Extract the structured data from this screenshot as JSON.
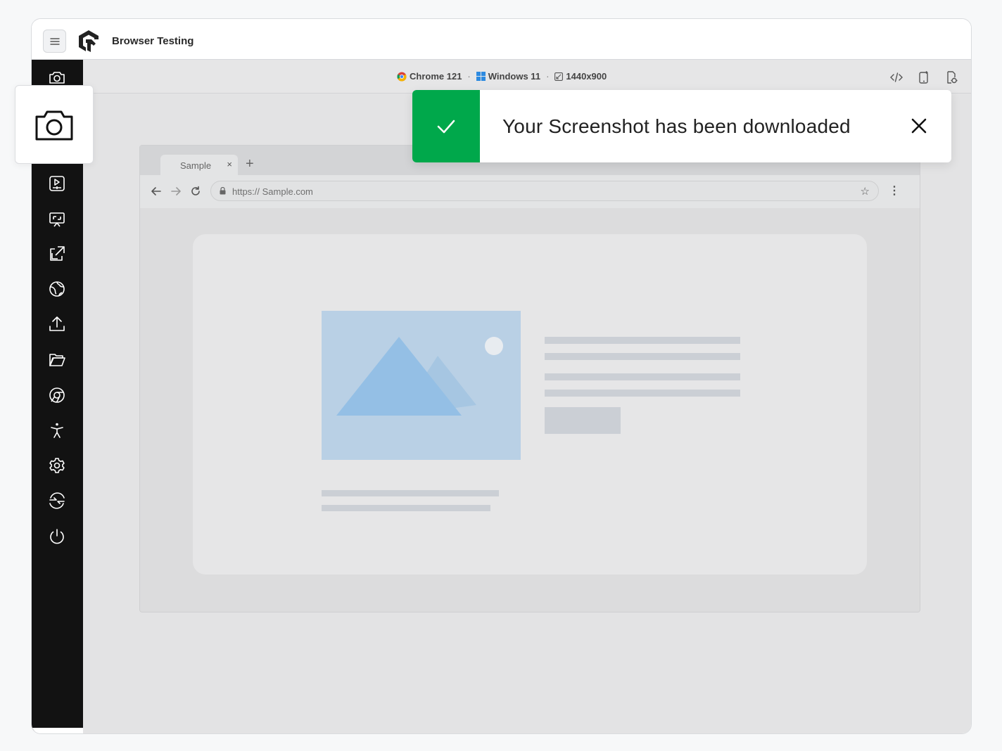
{
  "header": {
    "app_title": "Browser Testing",
    "menu_icon": "menu-icon",
    "logo": "brand-logo"
  },
  "sidebar": {
    "items": [
      {
        "name": "screenshot",
        "icon": "camera-icon"
      },
      {
        "name": "video-recording",
        "icon": "video-icon"
      },
      {
        "name": "switch-resolution",
        "icon": "monitor-icon"
      },
      {
        "name": "resize",
        "icon": "resize-icon"
      },
      {
        "name": "geolocation",
        "icon": "globe-icon"
      },
      {
        "name": "upload",
        "icon": "upload-icon"
      },
      {
        "name": "files",
        "icon": "folder-icon"
      },
      {
        "name": "switch-browser",
        "icon": "chrome-icon"
      },
      {
        "name": "accessibility",
        "icon": "accessibility-icon"
      },
      {
        "name": "settings",
        "icon": "gear-icon"
      },
      {
        "name": "tunnel",
        "icon": "switch-icon"
      },
      {
        "name": "end-session",
        "icon": "power-icon"
      }
    ]
  },
  "session": {
    "browser": "Chrome 121",
    "os": "Windows 11",
    "resolution": "1440x900"
  },
  "mock_browser": {
    "tab_label": "Sample",
    "tab_close": "×",
    "new_tab": "+",
    "url": "https:// Sample.com"
  },
  "toast": {
    "message": "Your Screenshot has been downloaded",
    "status_color": "#00a84b"
  },
  "colors": {
    "sidebar_bg": "#121212",
    "success": "#00a84b",
    "image_placeholder": "#b9d0e5"
  }
}
